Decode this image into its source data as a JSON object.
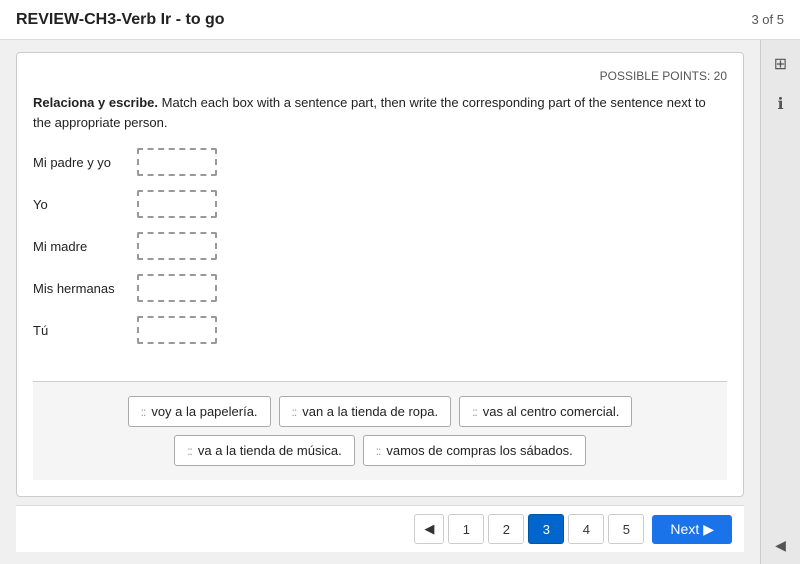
{
  "header": {
    "title": "REVIEW-CH3-Verb Ir - to go",
    "progress": "3 of 5"
  },
  "card": {
    "possible_points_label": "POSSIBLE POINTS: 20",
    "instructions_bold": "Relaciona y escribe.",
    "instructions_rest": " Match each box with a sentence part, then write the corresponding part of the sentence next to the appropriate person."
  },
  "match_rows": [
    {
      "label": "Mi padre y yo"
    },
    {
      "label": "Yo"
    },
    {
      "label": "Mi madre"
    },
    {
      "label": "Mis hermanas"
    },
    {
      "label": "Tú"
    }
  ],
  "tiles": [
    {
      "id": "tile1",
      "text": "voy a la papelería."
    },
    {
      "id": "tile2",
      "text": "van a la tienda de ropa."
    },
    {
      "id": "tile3",
      "text": "vas al centro comercial."
    },
    {
      "id": "tile4",
      "text": "va a la tienda de música."
    },
    {
      "id": "tile5",
      "text": "vamos de compras los sábados."
    }
  ],
  "footer": {
    "prev_arrow": "◀",
    "pages": [
      "1",
      "2",
      "3",
      "4",
      "5"
    ],
    "current_page": "3",
    "next_label": "Next",
    "next_arrow": "▶"
  },
  "sidebar": {
    "grid_icon": "⊞",
    "info_icon": "ℹ",
    "chevron": "◀"
  }
}
